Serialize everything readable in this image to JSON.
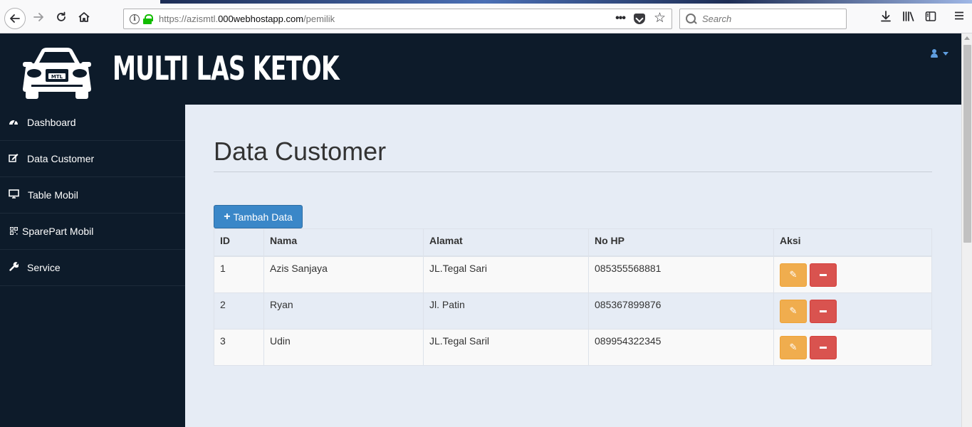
{
  "browser": {
    "url_prefix": "https://azismtl.",
    "url_domain": "000webhostapp.com",
    "url_path": "/pemilik",
    "search_placeholder": "Search",
    "page_actions_glyph": "•••"
  },
  "header": {
    "brand": "MULTI LAS KETOK",
    "logo_plate": "MTL"
  },
  "sidebar": {
    "items": [
      {
        "label": "Dashboard",
        "icon": "dashboard-icon"
      },
      {
        "label": "Data Customer",
        "icon": "edit-icon"
      },
      {
        "label": "Table Mobil",
        "icon": "monitor-icon"
      },
      {
        "label": "SparePart Mobil",
        "icon": "qrcode-icon"
      },
      {
        "label": "Service",
        "icon": "wrench-icon"
      }
    ]
  },
  "main": {
    "title": "Data Customer",
    "add_button": "Tambah Data",
    "table": {
      "headers": [
        "ID",
        "Nama",
        "Alamat",
        "No HP",
        "Aksi"
      ],
      "rows": [
        [
          "1",
          "Azis Sanjaya",
          "JL.Tegal Sari",
          "085355568881"
        ],
        [
          "2",
          "Ryan",
          "Jl. Patin",
          "085367899876"
        ],
        [
          "3",
          "Udin",
          "JL.Tegal Saril",
          "089954322345"
        ]
      ]
    }
  },
  "colors": {
    "navy": "#0d1b2a",
    "content_bg": "#e6ecf5",
    "primary": "#3a87c8",
    "warning": "#f0ad4e",
    "danger": "#d9534f"
  }
}
